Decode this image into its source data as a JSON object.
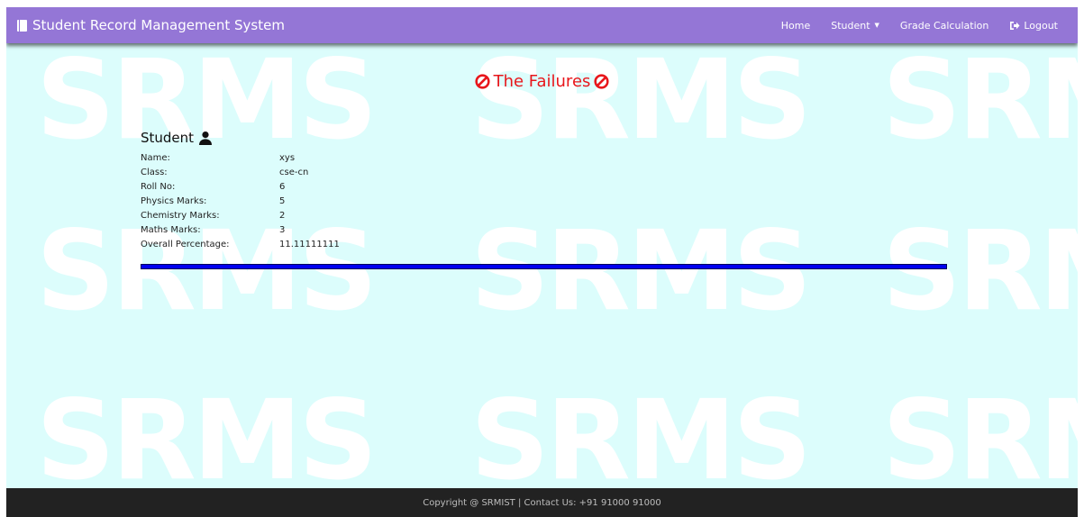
{
  "watermark": "SRMS",
  "navbar": {
    "brand": "Student Record Management System",
    "items": {
      "home": "Home",
      "student": "Student",
      "grade": "Grade Calculation",
      "logout": "Logout"
    }
  },
  "title": "The Failures",
  "student": {
    "heading": "Student",
    "fields": [
      {
        "label": "Name:",
        "value": "xys"
      },
      {
        "label": "Class:",
        "value": "cse-cn"
      },
      {
        "label": "Roll No:",
        "value": "6"
      },
      {
        "label": "Physics Marks:",
        "value": "5"
      },
      {
        "label": "Chemistry Marks:",
        "value": "2"
      },
      {
        "label": "Maths Marks:",
        "value": "3"
      },
      {
        "label": "Overall Percentage:",
        "value": "11.11111111"
      }
    ]
  },
  "footer": "Copyright @ SRMIST | Contact Us: +91 91000 91000",
  "colors": {
    "navbar": "#9476d6",
    "background": "#dcfdfc",
    "title": "#e8161b",
    "bar": "#0000ee",
    "footer": "#222222"
  }
}
